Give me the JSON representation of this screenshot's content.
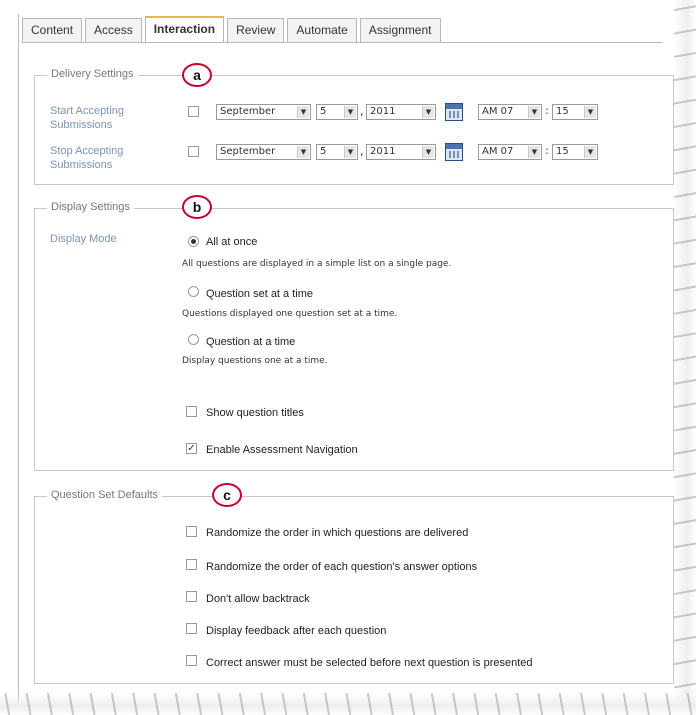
{
  "tabs": [
    {
      "label": "Content"
    },
    {
      "label": "Access"
    },
    {
      "label": "Interaction"
    },
    {
      "label": "Review"
    },
    {
      "label": "Automate"
    },
    {
      "label": "Assignment"
    }
  ],
  "active_tab": "Interaction",
  "delivery": {
    "legend": "Delivery Settings",
    "callout": "a",
    "start": {
      "label_line1": "Start Accepting",
      "label_line2": "Submissions",
      "month": "September",
      "day": "5",
      "year": "2011",
      "hour": "AM 07",
      "minute": "15"
    },
    "stop": {
      "label_line1": "Stop Accepting",
      "label_line2": "Submissions",
      "month": "September",
      "day": "5",
      "year": "2011",
      "hour": "AM 07",
      "minute": "15"
    },
    "comma": ",",
    "colon": ":"
  },
  "display": {
    "legend": "Display Settings",
    "callout": "b",
    "mode_label": "Display Mode",
    "options": [
      {
        "label": "All at once",
        "desc": "All questions are displayed in a simple list on a single page.",
        "checked": true
      },
      {
        "label": "Question set at a time",
        "desc": "Questions displayed one question set at a time.",
        "checked": false
      },
      {
        "label": "Question at a time",
        "desc": "Display questions one at a time.",
        "checked": false
      }
    ],
    "show_titles": {
      "label": "Show question titles",
      "checked": false
    },
    "enable_nav": {
      "label": "Enable Assessment Navigation",
      "checked": true
    }
  },
  "qset": {
    "legend": "Question Set Defaults",
    "callout": "c",
    "items": [
      {
        "label": "Randomize the order in which questions are delivered",
        "checked": false
      },
      {
        "label": "Randomize the order of each question's answer options",
        "checked": false
      },
      {
        "label": "Don't allow backtrack",
        "checked": false
      },
      {
        "label": "Display feedback after each question",
        "checked": false
      },
      {
        "label": "Correct answer must be selected before next question is presented",
        "checked": false
      }
    ]
  },
  "icons": {
    "calendar": "calendar-icon",
    "dropdown": "chevron-down-icon"
  },
  "colors": {
    "label_blue": "#7c93b4",
    "callout_red": "#c4002b",
    "tab_accent": "#e7b84a"
  }
}
